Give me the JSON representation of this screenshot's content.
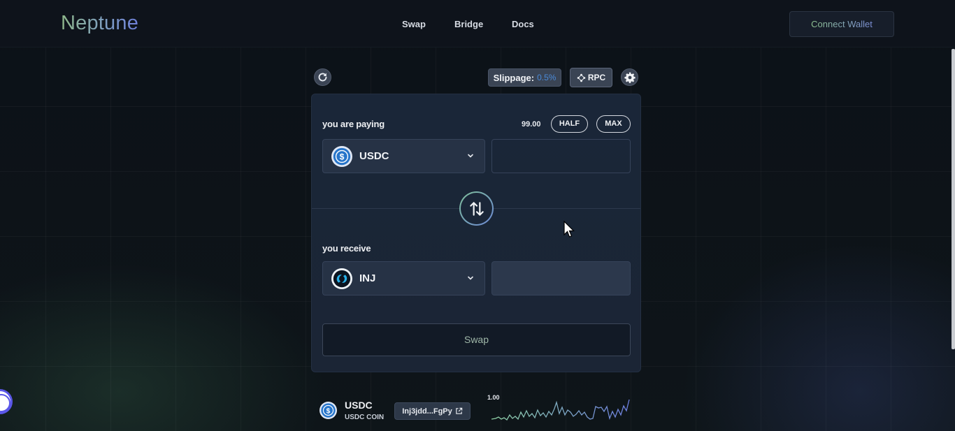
{
  "header": {
    "logo": "Neptune",
    "nav": [
      "Swap",
      "Bridge",
      "Docs"
    ],
    "connect_label": "Connect Wallet"
  },
  "toolbar": {
    "slippage_label": "Slippage:",
    "slippage_value": "0.5%",
    "rpc_label": "RPC"
  },
  "pay": {
    "label": "you are paying",
    "balance": "99.00",
    "half_label": "HALF",
    "max_label": "MAX",
    "token": "USDC",
    "amount": ""
  },
  "receive": {
    "label": "you receive",
    "token": "INJ",
    "amount": ""
  },
  "swap_button": "Swap",
  "token_info": {
    "symbol": "USDC",
    "name": "USDC COIN",
    "address": "Inj3jdd...FgPy",
    "chart_top_label": "1.00"
  },
  "colors": {
    "accent_green": "#8fc38f",
    "accent_blue": "#6d89d4",
    "card_bg": "#1a2638",
    "slippage_value": "#4a8ad8"
  },
  "icons": {
    "refresh": "refresh-icon",
    "settings": "gear-icon",
    "rpc": "network-icon",
    "switch": "swap-arrows-icon",
    "external": "external-link-icon"
  }
}
